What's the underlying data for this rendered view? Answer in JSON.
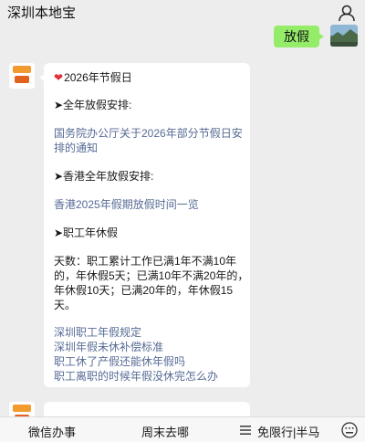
{
  "header": {
    "title": "深圳本地宝",
    "profile_icon": "person-icon"
  },
  "chat": {
    "user_message": "放假",
    "bot_message": {
      "heading": "2026年节假日",
      "section1": "➤全年放假安排:",
      "link1_line1": "国务院办公厅关于2026年部分节假日安",
      "link1_line2": "排的通知",
      "section2": "➤香港全年放假安排:",
      "link2": "香港2025年假期放假时间一览",
      "section3": "➤职工年休假",
      "body_line1": "天数：职工累计工作已满1年不满10年",
      "body_line2": "的，年休假5天；已满10年不满20年的，",
      "body_line3": "年休假10天；已满20年的，年休假15",
      "body_line4": "天。",
      "related_links": [
        "深圳职工年假规定",
        "深圳年假未休补偿标准",
        "职工休了产假还能休年假吗",
        "职工离职的时候年假没休完怎么办"
      ]
    }
  },
  "bottom_menu": {
    "items": [
      "微信办事",
      "周末去哪",
      "免限行|半马"
    ],
    "icons": [
      "menu-icon",
      "keyboard-icon"
    ]
  },
  "colors": {
    "link": "#576b95",
    "user_bubble": "#95ec69",
    "background": "#ededed",
    "heart": "#e0303a"
  }
}
